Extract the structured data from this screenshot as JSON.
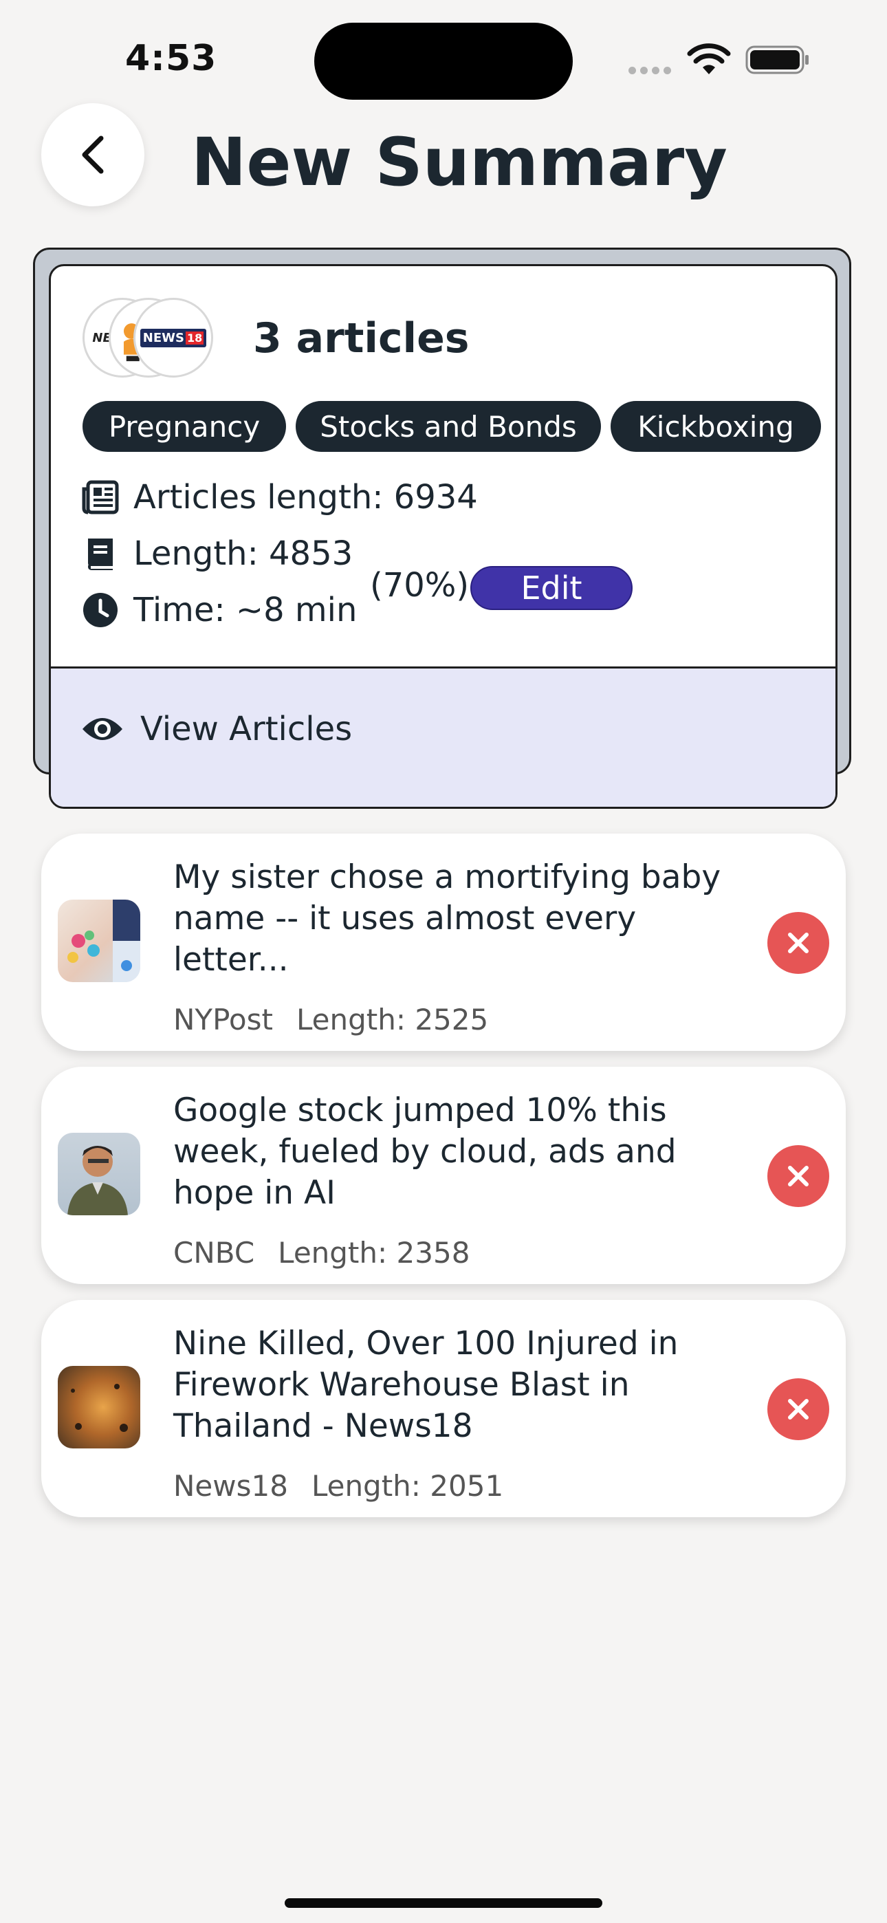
{
  "status_bar": {
    "time": "4:53"
  },
  "header": {
    "title": "New Summary"
  },
  "summary": {
    "articles_count": "3 articles",
    "logos": [
      {
        "name": "NYPost",
        "text": "NEW"
      },
      {
        "name": "CNBC",
        "text": ""
      },
      {
        "name": "News18",
        "text": "NEWS",
        "badge": "18"
      }
    ],
    "tags": [
      "Pregnancy",
      "Stocks and Bonds",
      "Kickboxing"
    ],
    "articles_length": "Articles length: 6934",
    "length": "Length: 4853",
    "time": "Time: ~8 min",
    "percent": "(70%)",
    "edit_label": "Edit",
    "view_articles_label": "View Articles"
  },
  "articles": [
    {
      "title": "My sister chose a mortifying baby name --  it uses almost every letter...",
      "source": "NYPost",
      "length": "Length: 2525"
    },
    {
      "title": "Google stock jumped 10% this week, fueled by cloud, ads and hope in AI",
      "source": "CNBC",
      "length": "Length: 2358"
    },
    {
      "title": "Nine Killed, Over 100 Injured in Firework Warehouse Blast in Thailand - News18",
      "source": "News18",
      "length": "Length: 2051"
    }
  ],
  "colors": {
    "accent": "#4033a8",
    "dark": "#1c2730",
    "remove": "#e65555",
    "view_bg": "#e6e7f8"
  }
}
